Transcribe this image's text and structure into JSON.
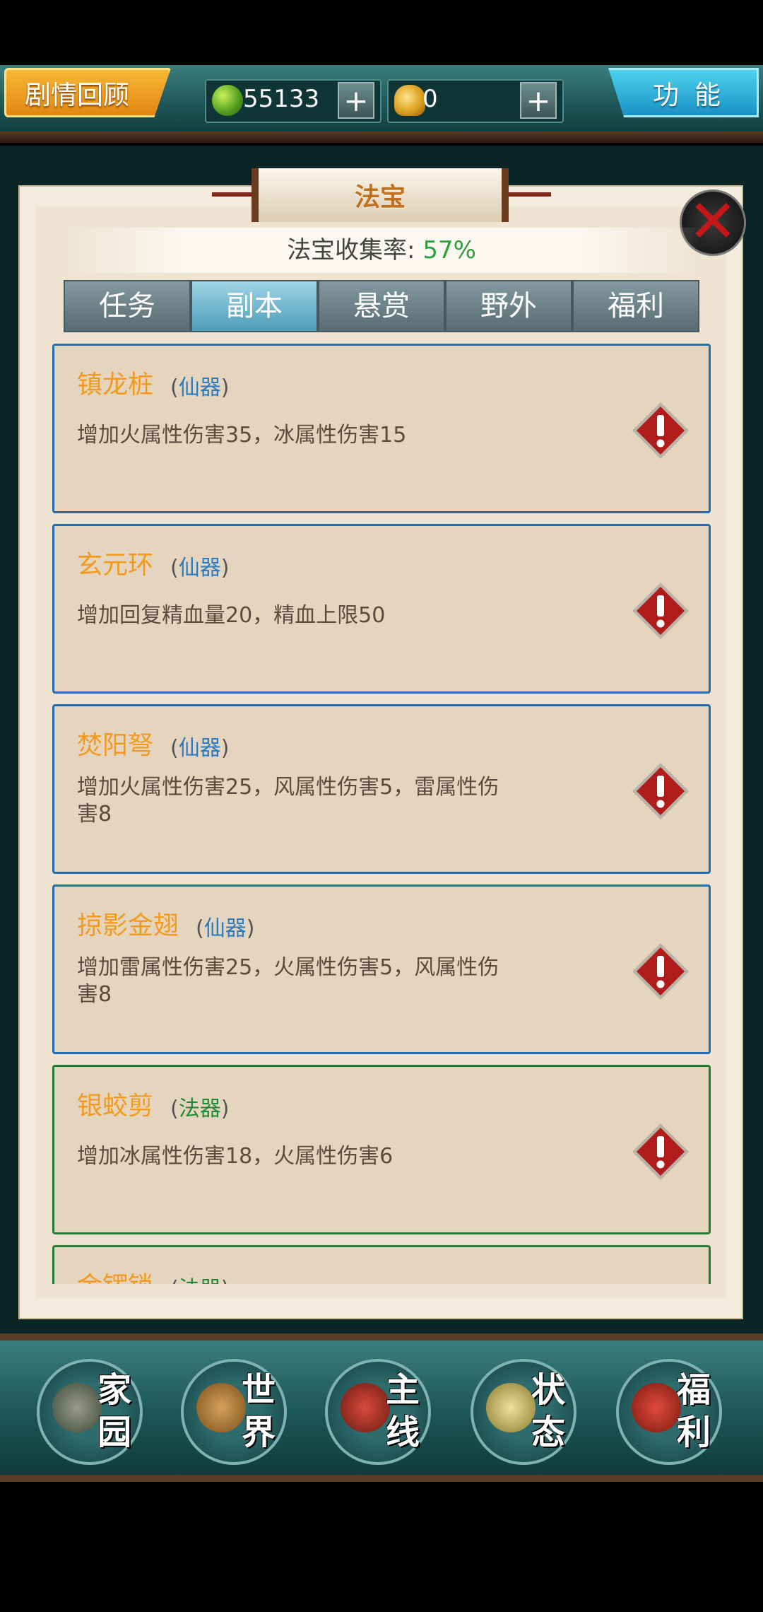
{
  "topbar": {
    "story_label": "剧情回顾",
    "jade_value": "55133",
    "gold_value": "0",
    "plus_symbol": "+",
    "function_label": "功能"
  },
  "panel": {
    "title": "法宝",
    "collect_label": "法宝收集率:",
    "collect_percent": "57%",
    "close_symbol": "✕"
  },
  "tabs": [
    {
      "label": "任务",
      "active": false
    },
    {
      "label": "副本",
      "active": true
    },
    {
      "label": "悬赏",
      "active": false
    },
    {
      "label": "野外",
      "active": false
    },
    {
      "label": "福利",
      "active": false
    }
  ],
  "items": [
    {
      "name": "镇龙桩",
      "type": "仙器",
      "desc": "增加火属性伤害35，冰属性伤害15",
      "rarity": "blue"
    },
    {
      "name": "玄元环",
      "type": "仙器",
      "desc": "增加回复精血量20，精血上限50",
      "rarity": "blue"
    },
    {
      "name": "焚阳弩",
      "type": "仙器",
      "desc": "增加火属性伤害25，风属性伤害5，雷属性伤害8",
      "rarity": "blue"
    },
    {
      "name": "掠影金翅",
      "type": "仙器",
      "desc": "增加雷属性伤害25，火属性伤害5，风属性伤害8",
      "rarity": "blue"
    },
    {
      "name": "银蛟剪",
      "type": "法器",
      "desc": "增加冰属性伤害18，火属性伤害6",
      "rarity": "green"
    },
    {
      "name": "金锣锁",
      "type": "法器",
      "desc": "",
      "rarity": "green"
    }
  ],
  "bottom_nav": [
    {
      "label": "家园",
      "icon": "home-icon"
    },
    {
      "label": "世界",
      "icon": "world-icon"
    },
    {
      "label": "主线",
      "icon": "main-quest-icon"
    },
    {
      "label": "状态",
      "icon": "status-icon"
    },
    {
      "label": "福利",
      "icon": "welfare-icon"
    }
  ],
  "colors": {
    "item_name": "#f19a1e",
    "rarity_blue": "#1f6cb0",
    "rarity_green": "#1f7d34",
    "collect_percent": "#2f9e3d"
  }
}
